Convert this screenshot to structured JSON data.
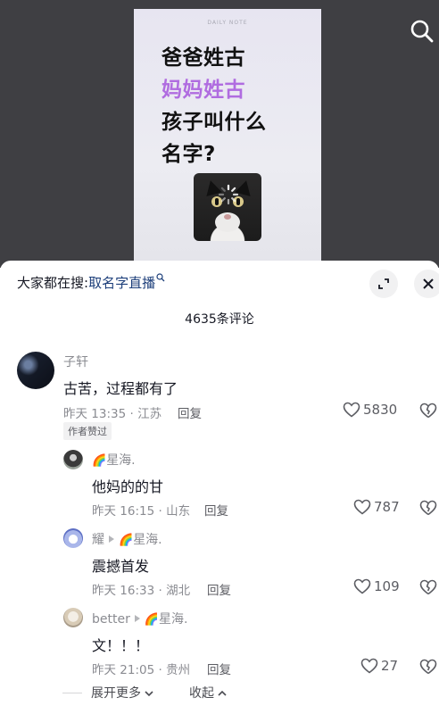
{
  "video": {
    "note_brand": "DAILY NOTE",
    "lines": [
      "爸爸姓古",
      "妈妈姓古",
      "孩子叫什么",
      "名字?"
    ]
  },
  "sheet": {
    "search_prefix": "大家都在搜:",
    "search_keyword": "取名字直播",
    "comment_count": "4635条评论",
    "expand_more": "展开更多",
    "collapse": "收起"
  },
  "comments": {
    "main": {
      "user": "子轩",
      "text": "古苦，过程都有了",
      "meta": "昨天 13:35 · 江苏",
      "reply_label": "回复",
      "likes": "5830",
      "badge": "作者赞过"
    },
    "replies": [
      {
        "from": "",
        "to": "星海.",
        "text": "他妈的的甘",
        "meta": "昨天 16:15 · 山东",
        "reply_label": "回复",
        "likes": "787"
      },
      {
        "from": "耀",
        "to": "星海.",
        "text": "震撼首发",
        "meta": "昨天 16:33 · 湖北",
        "reply_label": "回复",
        "likes": "109"
      },
      {
        "from": "better",
        "to": "星海.",
        "text": "文！！！",
        "meta": "昨天 21:05 · 贵州",
        "reply_label": "回复",
        "likes": "27"
      }
    ]
  },
  "icons": {
    "rainbow": "🌈"
  },
  "colors": {
    "accent_purple": "#b06ce0",
    "keyword_blue": "#1c3e7a",
    "muted_text": "#8a8b91"
  }
}
